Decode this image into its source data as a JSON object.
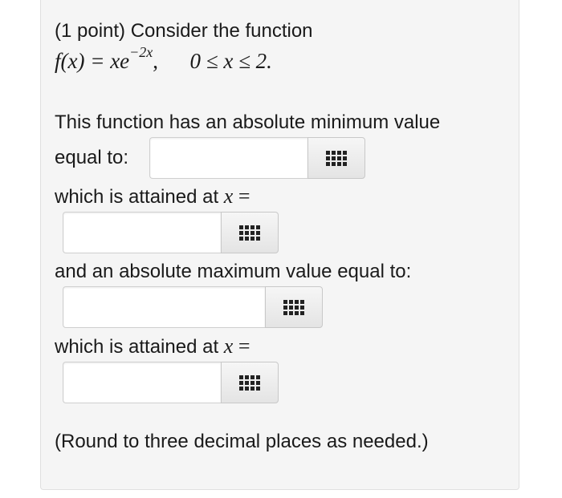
{
  "problem": {
    "intro": "(1 point) Consider the function",
    "function_lhs": "f(x) = xe",
    "function_exponent": "−2x",
    "function_sep": ",",
    "domain_text": "0 ≤ x ≤ 2."
  },
  "questions": {
    "min_value_line1": "This function has an absolute minimum value",
    "min_value_line2": "equal to:",
    "min_at_prefix": "which is attained at",
    "max_value_label": "and an absolute maximum value equal to:",
    "max_at_prefix": "which is attained at",
    "x_var": "x",
    "equals": "="
  },
  "answers": {
    "min_value": "",
    "min_x": "",
    "max_value": "",
    "max_x": ""
  },
  "footer": {
    "note": "(Round to three decimal places as needed.)"
  },
  "icons": {
    "palette": "grid-icon"
  },
  "colors": {
    "panel_background": "#f5f5f5",
    "text": "#1a1a1a"
  }
}
